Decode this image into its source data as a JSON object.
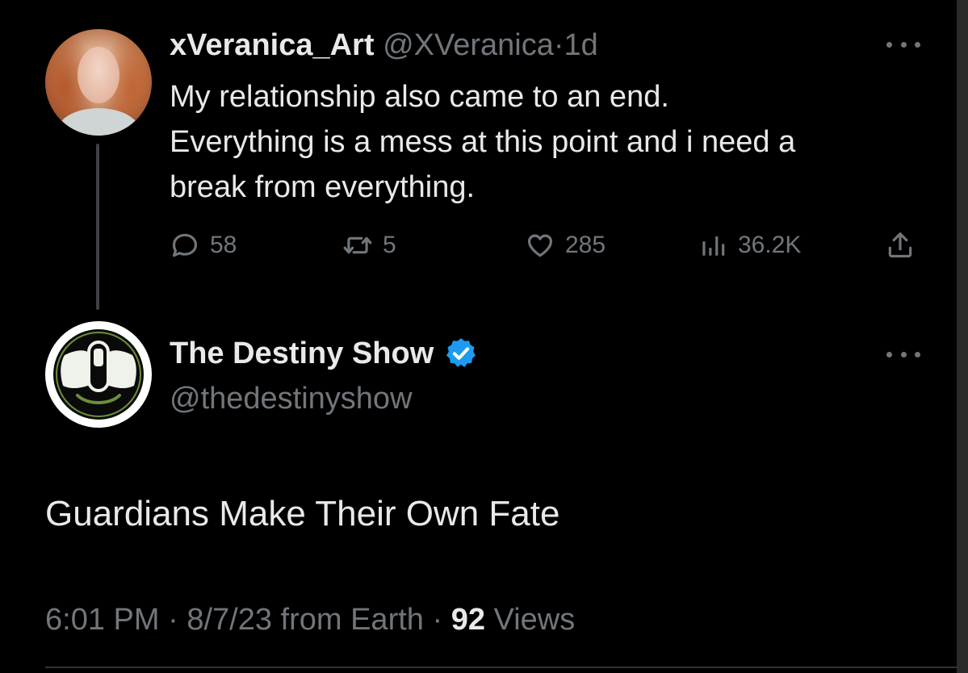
{
  "parent_tweet": {
    "display_name": "xVeranica_Art",
    "handle": "@XVeranica",
    "separator": "·",
    "age": "1d",
    "text_lines": [
      "My relationship also came to an end.",
      "Everything is a mess at this point and i need a",
      "break from everything."
    ],
    "actions": {
      "replies": "58",
      "reposts": "5",
      "likes": "285",
      "views": "36.2K"
    }
  },
  "quoted_tweet": {
    "display_name": "The Destiny Show",
    "handle": "@thedestinyshow",
    "verified": true,
    "text": "Guardians Make Their Own Fate",
    "time": "6:01 PM",
    "date": "8/7/23",
    "source": "from Earth",
    "views_count": "92",
    "views_label": "Views"
  },
  "colors": {
    "background": "#000000",
    "primary_text": "#e7e9ea",
    "secondary_text": "#71767b",
    "verified_blue": "#1d9bf0",
    "thread_line": "#3e4144"
  },
  "icons": {
    "reply": "reply-icon",
    "repost": "repost-icon",
    "like": "heart-icon",
    "views": "analytics-icon",
    "share": "share-icon",
    "more": "more-icon",
    "verified": "verified-badge-icon"
  }
}
